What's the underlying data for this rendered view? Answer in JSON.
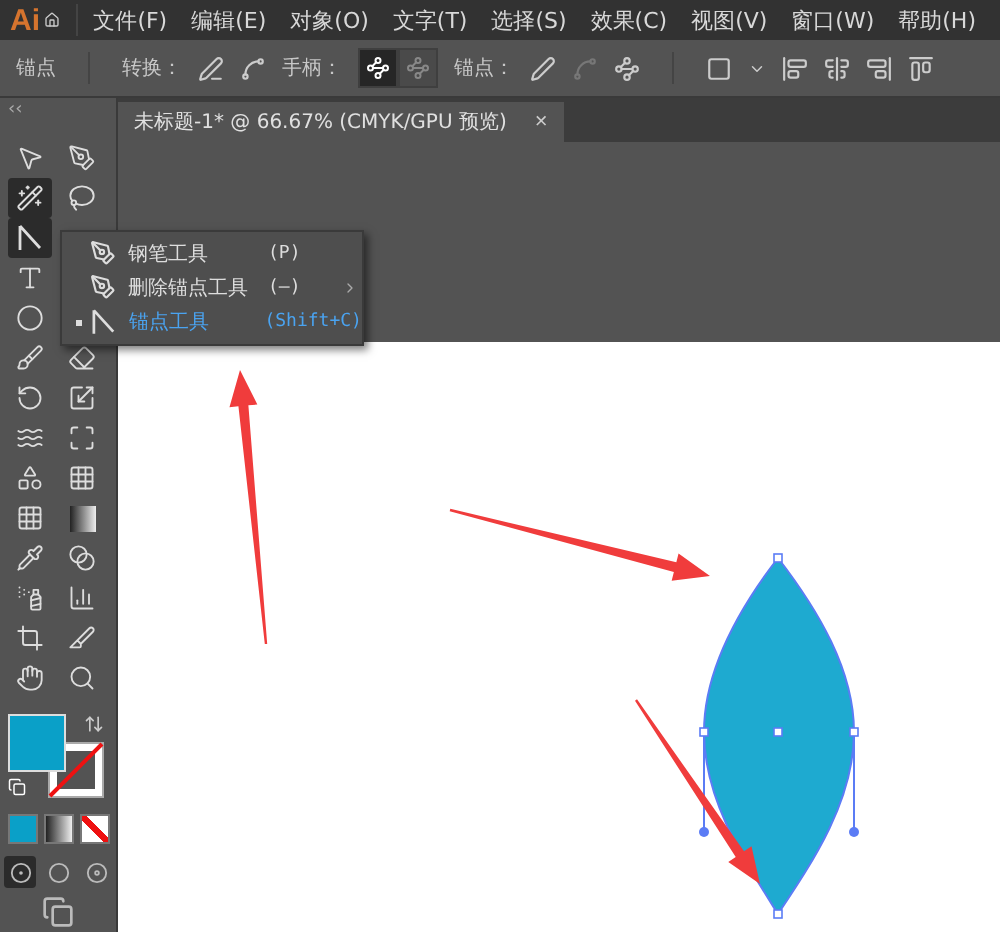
{
  "app_logo": "Ai",
  "menu": [
    "文件(F)",
    "编辑(E)",
    "对象(O)",
    "文字(T)",
    "选择(S)",
    "效果(C)",
    "视图(V)",
    "窗口(W)",
    "帮助(H)"
  ],
  "control_bar": {
    "label": "锚点",
    "convert_label": "转换：",
    "handles_label": "手柄：",
    "handle_buttons": [
      {
        "selected": true
      },
      {
        "selected": false
      }
    ],
    "anchors_label": "锚点："
  },
  "document_tab": {
    "title": "未标题-1* @ 66.67% (CMYK/GPU 预览)",
    "close": "×"
  },
  "toolbar": {
    "collapse": "‹‹",
    "tools": [
      {
        "selected": false
      },
      {
        "selected": false
      },
      {
        "selected": true
      },
      {
        "selected": false
      },
      {
        "selected": true
      },
      {
        "selected": false
      },
      {
        "selected": false
      },
      {
        "selected": false
      },
      {
        "selected": false
      },
      {
        "selected": false
      },
      {
        "selected": false
      },
      {
        "selected": false
      },
      {
        "selected": false
      },
      {
        "selected": false
      },
      {
        "selected": false
      },
      {
        "selected": false
      },
      {
        "selected": false
      },
      {
        "selected": false
      },
      {
        "selected": false
      },
      {
        "selected": false
      },
      {
        "selected": false
      },
      {
        "selected": false
      },
      {
        "selected": false
      },
      {
        "selected": false
      },
      {
        "selected": false
      }
    ],
    "draw_modes": [
      {
        "selected": true
      },
      {
        "selected": false
      },
      {
        "selected": false
      }
    ]
  },
  "flyout_menu": [
    {
      "label": "钢笔工具",
      "shortcut": "(P)",
      "selected": false
    },
    {
      "label": "删除锚点工具",
      "shortcut": "(–)",
      "selected": false
    },
    {
      "label": "锚点工具",
      "shortcut": "(Shift+C)",
      "selected": true
    }
  ]
}
